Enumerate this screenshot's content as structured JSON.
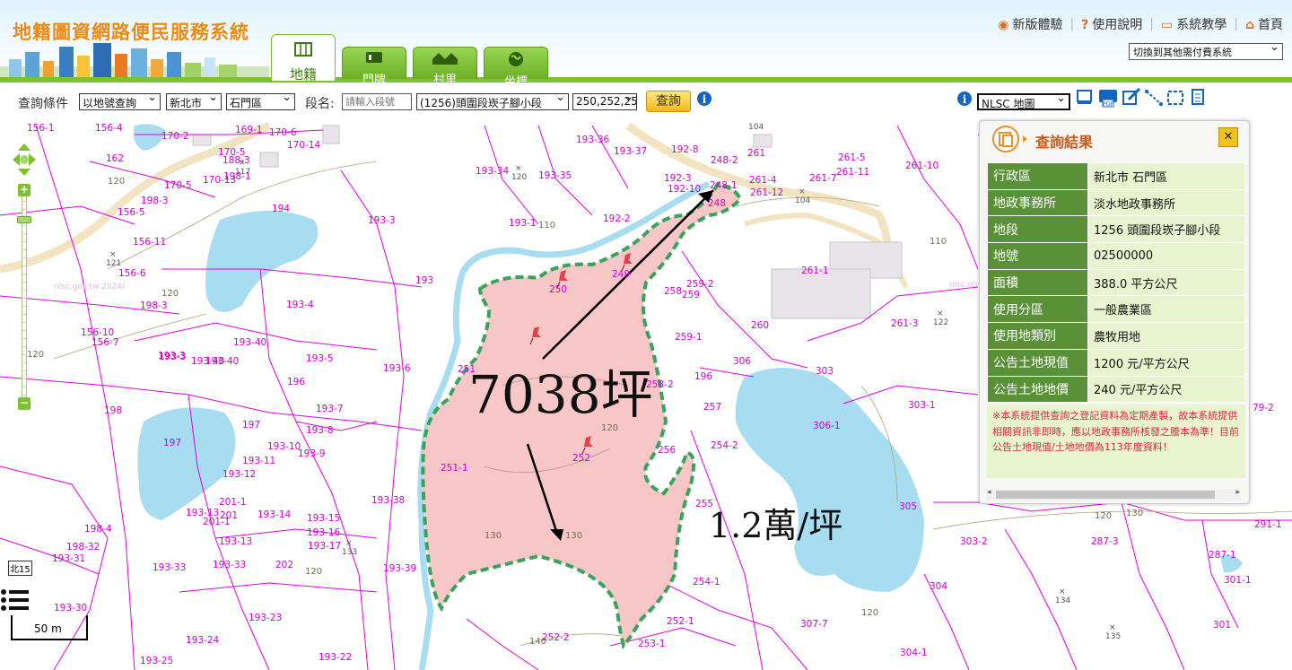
{
  "header": {
    "title": "地籍圖資網路便民服務系統",
    "tabs": [
      {
        "label": "地籍",
        "icon": "map-icon"
      },
      {
        "label": "門牌",
        "icon": "signpost-icon"
      },
      {
        "label": "村里",
        "icon": "village-icon"
      },
      {
        "label": "坐標",
        "icon": "globe-icon"
      }
    ],
    "links": [
      {
        "label": "新版體驗",
        "icon": "new-version-icon"
      },
      {
        "label": "使用說明",
        "icon": "help-book-icon"
      },
      {
        "label": "系統教學",
        "icon": "tutorial-icon"
      },
      {
        "label": "首頁",
        "icon": "home-icon"
      }
    ],
    "switch_select": "切換到其他需付費系統"
  },
  "query": {
    "condition_label": "查詢條件",
    "type_select": "以地號查詢",
    "city_select": "新北市",
    "district_select": "石門區",
    "section_label": "段名:",
    "section_placeholder": "請輸入段號",
    "section_select": "(1256)頭圍段崁子腳小段",
    "parcel_input": "250,252,25",
    "submit": "查詢",
    "basemap_select": "NLSC 地圖"
  },
  "map": {
    "parcel_labels": [
      "156-1",
      "156-4",
      "170-2",
      "169-1",
      "170-6",
      "170-14",
      "170-5",
      "188-3",
      "162",
      "170-5",
      "170-13",
      "198-1",
      "193-36",
      "193-37",
      "192-8",
      "248-2",
      "261",
      "261-5",
      "261-11",
      "261-10",
      "193-34",
      "193-35",
      "192-3",
      "192-10",
      "248-1",
      "261-4",
      "261-12",
      "261-7",
      "198-3",
      "194",
      "193-3",
      "193-1",
      "192-2",
      "248",
      "156-5",
      "156-11",
      "156-6",
      "193",
      "250",
      "249",
      "258",
      "259",
      "261-1",
      "198-3",
      "193-4",
      "259-2",
      "193-40",
      "193-3",
      "193-40",
      "251",
      "193-6",
      "260",
      "261-3",
      "259-1",
      "193-5",
      "306",
      "303",
      "196",
      "258-2",
      "196",
      "198",
      "193-7",
      "257",
      "306-1",
      "303-1",
      "197",
      "193-8",
      "193-10",
      "193-9",
      "254-2",
      "197",
      "193-11",
      "193-12",
      "251-1",
      "252",
      "256",
      "201-1",
      "201",
      "193-13",
      "201-1",
      "193-14",
      "193-38",
      "255",
      "305",
      "198-4",
      "198-32",
      "193-13",
      "193-15",
      "193-16",
      "193-17",
      "303-2",
      "287-3",
      "291-1",
      "193-31",
      "193-33",
      "193-33",
      "202",
      "193-39",
      "254-1",
      "287-1",
      "304",
      "301-1",
      "193-30",
      "193-23",
      "252-1",
      "307-7",
      "301",
      "193-24",
      "193-25",
      "193-22",
      "252-2",
      "253-1",
      "304-1",
      "156-10",
      "156-7",
      "193-3",
      "193-40",
      "79-2"
    ],
    "contour_labels": [
      "120",
      "110",
      "110",
      "120",
      "120",
      "120",
      "130",
      "130",
      "140",
      "120",
      "130",
      "120",
      "120"
    ],
    "spot_heights": [
      "120",
      "121",
      "117",
      "133",
      "122",
      "134",
      "135",
      "104",
      "104"
    ],
    "watermarks": [
      "nlsc.gov.tw 2024/",
      "nlsc.gov.tw"
    ],
    "road_marker": "北15",
    "scale_label": "50 m"
  },
  "annotations": {
    "area_text": "7038坪",
    "price_text": "1.2萬/坪"
  },
  "result_panel": {
    "title": "查詢結果",
    "rows": [
      {
        "key": "行政區",
        "value": "新北市 石門區"
      },
      {
        "key": "地政事務所",
        "value": "淡水地政事務所"
      },
      {
        "key": "地段",
        "value": "1256 頭圍段崁子腳小段"
      },
      {
        "key": "地號",
        "value": "02500000"
      },
      {
        "key": "面積",
        "value": "388.0 平方公尺"
      },
      {
        "key": "使用分區",
        "value": "一般農業區"
      },
      {
        "key": "使用地類別",
        "value": "農牧用地"
      },
      {
        "key": "公告土地現值",
        "value": "1200 元/平方公尺"
      },
      {
        "key": "公告土地地價",
        "value": "240 元/平方公尺"
      }
    ],
    "note": "※本系統提供查詢之登記資料為定期產製，故本系統提供相關資訊非即時，應以地政事務所核發之謄本為準！目前公告土地現值/土地地價為113年度資料！"
  },
  "colors": {
    "header_green": "#7cc12f",
    "title_orange": "#e98a16",
    "parcel_line": "#e000e0",
    "water": "#a8dcf0",
    "highlight_fill": "#f7c6c6",
    "highlight_border": "#3aa35b",
    "panel_key_bg": "#5a9138",
    "panel_value_bg": "#e7f4cf",
    "note_red": "#e0253f"
  }
}
